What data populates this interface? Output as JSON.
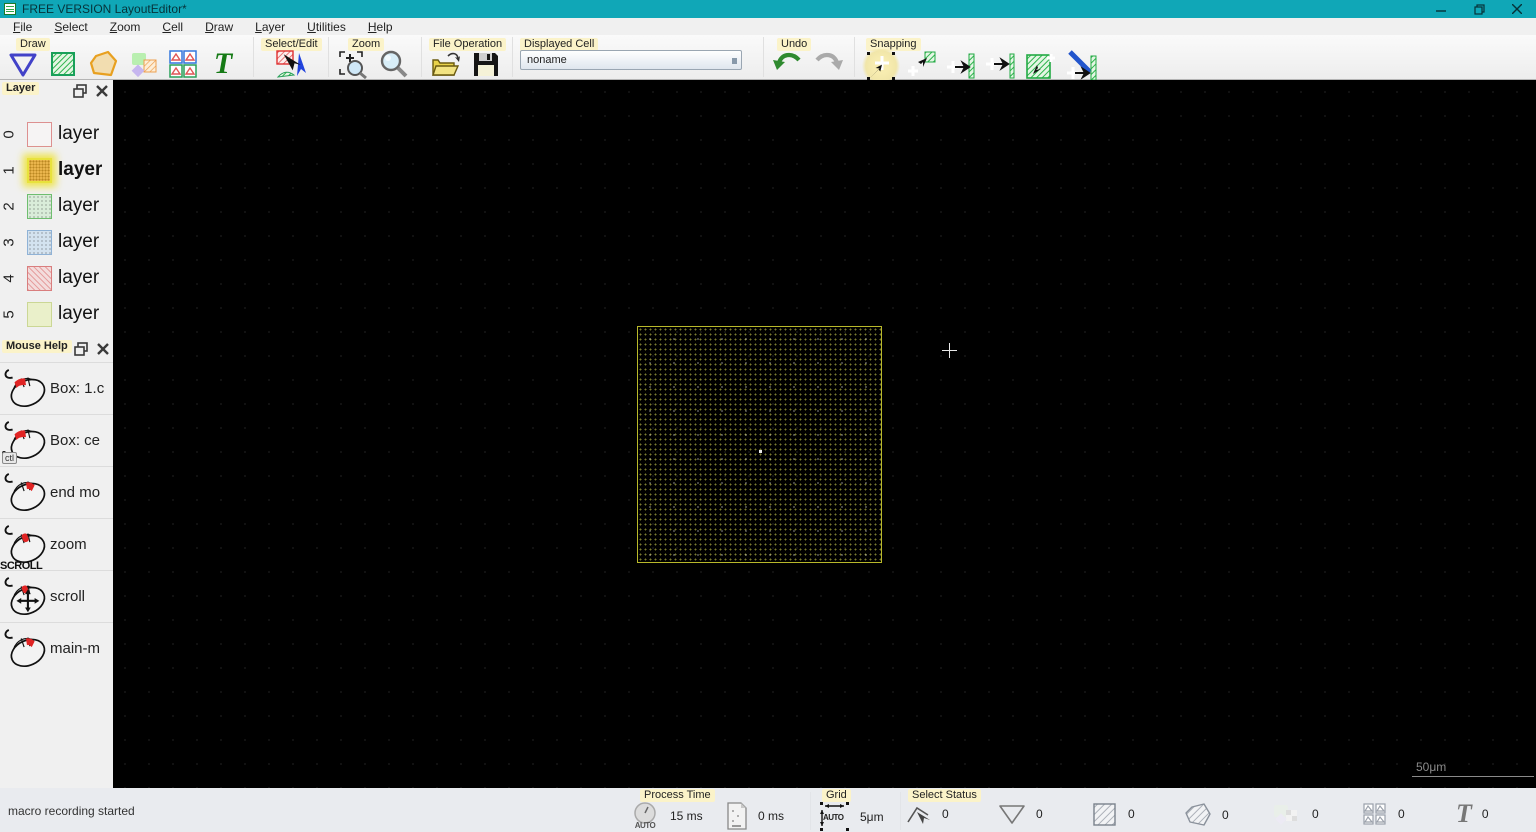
{
  "window": {
    "title": "FREE VERSION LayoutEditor*"
  },
  "menu": {
    "items": [
      "File",
      "Select",
      "Zoom",
      "Cell",
      "Draw",
      "Layer",
      "Utilities",
      "Help"
    ]
  },
  "toolbar": {
    "draw_label": "Draw",
    "select_edit_label": "Select/Edit",
    "zoom_label": "Zoom",
    "file_operation_label": "File Operation",
    "displayed_cell_label": "Displayed Cell",
    "displayed_cell_value": "noname",
    "undo_label": "Undo",
    "snapping_label": "Snapping"
  },
  "layer_panel": {
    "title": "Layer",
    "layers": [
      {
        "index": "0",
        "label": "layer",
        "fill": "#f6f4f4",
        "border": "#dd9090"
      },
      {
        "index": "1",
        "label": "layer",
        "fill": "#e9b44c",
        "border": "#e8e23c"
      },
      {
        "index": "2",
        "label": "layer",
        "fill": "#d9ecd9",
        "border": "#6fbe6f"
      },
      {
        "index": "3",
        "label": "layer",
        "fill": "#d3e2ef",
        "border": "#8fb2d6"
      },
      {
        "index": "4",
        "label": "layer",
        "fill": "#f3dcdc",
        "border": "#d97e7e"
      },
      {
        "index": "5",
        "label": "layer",
        "fill": "#eaf0ca",
        "border": "#cbd795"
      }
    ]
  },
  "mouse_help": {
    "title": "Mouse Help",
    "items": [
      {
        "label": "Box: 1.c",
        "button": "left"
      },
      {
        "label": "Box: ce",
        "button": "left",
        "modifier": "ctl"
      },
      {
        "label": "end mo",
        "button": "right"
      },
      {
        "label": "zoom",
        "button": "wheel",
        "extra": "SCROLL"
      },
      {
        "label": "scroll",
        "button": "middle-drag"
      },
      {
        "label": "main-m",
        "button": "right"
      }
    ]
  },
  "canvas": {
    "scale_label": "50μm"
  },
  "status_bar": {
    "message": "macro recording started",
    "process_time": {
      "label": "Process Time",
      "auto_badge": "AUTO",
      "auto_value": "15 ms",
      "doc_value": "0 ms"
    },
    "grid": {
      "label": "Grid",
      "auto_badge": "AUTO",
      "value": "5μm"
    },
    "select_status": {
      "label": "Select Status",
      "counts": [
        "0",
        "0",
        "0",
        "0",
        "0",
        "0",
        "0"
      ]
    },
    "text_glyph": "T"
  },
  "colors": {
    "titlebar": "#10a7b7",
    "canvas_bg": "#000000",
    "cell_outline": "#b9b92a",
    "tag_bg": "#fbf3c9"
  }
}
